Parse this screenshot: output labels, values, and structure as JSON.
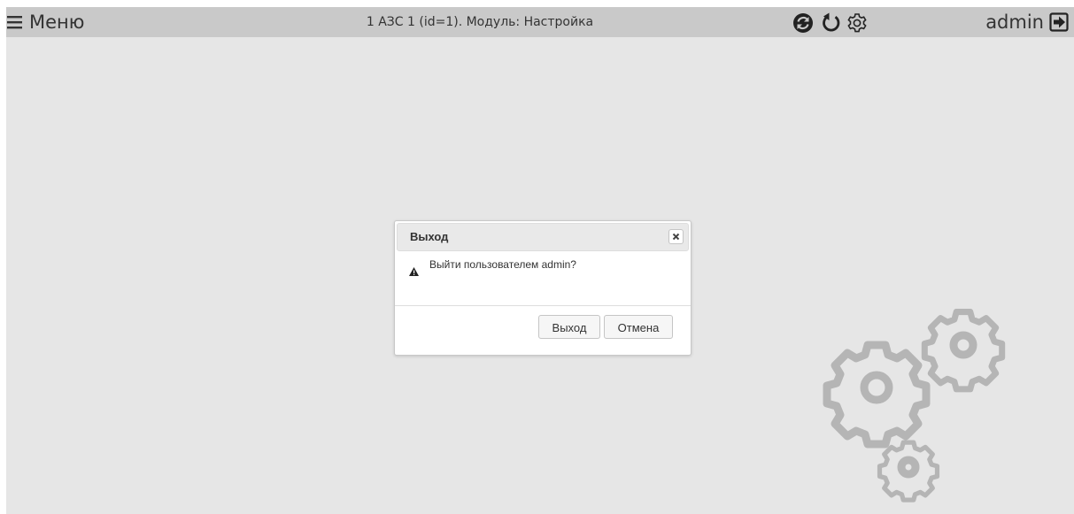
{
  "header": {
    "menu_label": "Меню",
    "title": "1 АЗС 1 (id=1). Модуль: Настройка",
    "user_name": "admin",
    "icons": [
      "sync-icon",
      "refresh-icon",
      "settings-icon",
      "logout-icon"
    ]
  },
  "dialog": {
    "title": "Выход",
    "message": "Выйти пользователем admin?",
    "confirm_label": "Выход",
    "cancel_label": "Отмена"
  },
  "colors": {
    "background": "#e6e6e6",
    "header": "#c9c9c9",
    "gear": "#bdbdbd"
  }
}
